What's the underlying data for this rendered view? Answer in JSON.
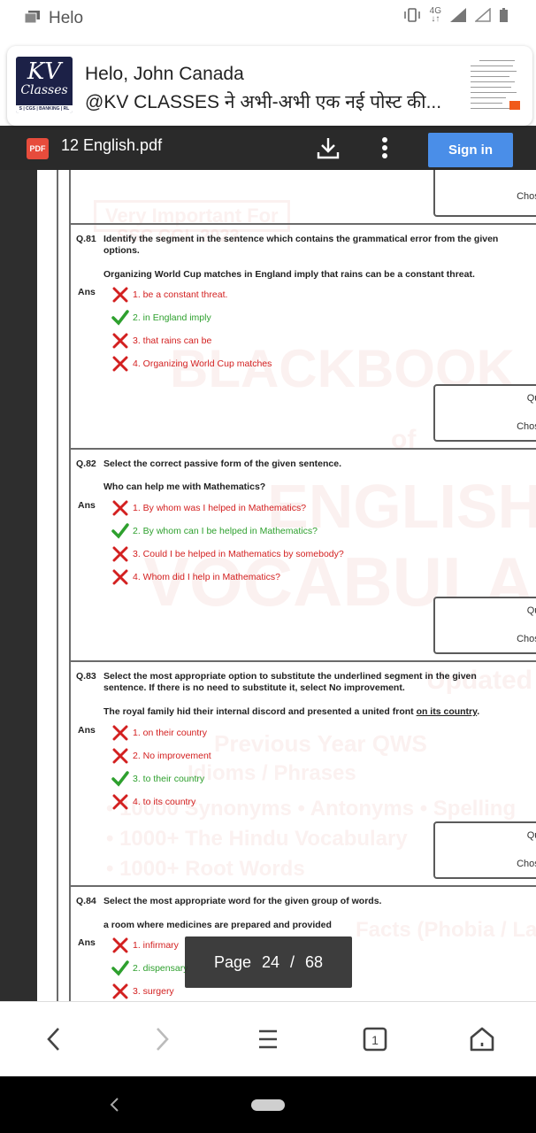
{
  "status_bar": {
    "title": "Helo",
    "network": "4G"
  },
  "notification": {
    "logo": {
      "kv": "KV",
      "classes": "Classes",
      "band": "S | CGS | BANKING | RL"
    },
    "title": "Helo, John Canada",
    "text": "@KV CLASSES ने अभी-अभी एक नई पोस्ट की..."
  },
  "pdf_header": {
    "badge": "PDF",
    "title": "12 English.pdf",
    "signin_label": "Sign in"
  },
  "document": {
    "info_labels": {
      "question_id": "Ques",
      "chosen_option": "Chosen"
    },
    "ans_label": "Ans",
    "questions": [
      {
        "number": "Q.81",
        "text": "Identify the segment in the sentence which contains the grammatical error from the given options.",
        "sentence": "Organizing World Cup matches in England imply that rains can be a constant threat.",
        "options": [
          {
            "label": "1. be a constant threat.",
            "correct": false
          },
          {
            "label": "2. in England imply",
            "correct": true
          },
          {
            "label": "3. that rains can be",
            "correct": false
          },
          {
            "label": "4. Organizing World Cup matches",
            "correct": false
          }
        ]
      },
      {
        "number": "Q.82",
        "text": "Select the correct passive form of the given sentence.",
        "sentence": "Who can help me with Mathematics?",
        "options": [
          {
            "label": "1. By whom was I helped in Mathematics?",
            "correct": false
          },
          {
            "label": "2. By whom can I be helped in Mathematics?",
            "correct": true
          },
          {
            "label": "3. Could I be helped in Mathematics by somebody?",
            "correct": false
          },
          {
            "label": "4. Whom did I help in Mathematics?",
            "correct": false
          }
        ]
      },
      {
        "number": "Q.83",
        "text": "Select the most appropriate option to substitute the underlined segment in the given sentence. If there is no need to substitute it, select No improvement.",
        "sentence_before": "The royal family hid their internal discord and presented a united front ",
        "sentence_underlined": "on its country",
        "sentence_after": ".",
        "options": [
          {
            "label": "1. on their country",
            "correct": false
          },
          {
            "label": "2. No improvement",
            "correct": false
          },
          {
            "label": "3. to their country",
            "correct": true
          },
          {
            "label": "4. to its country",
            "correct": false
          }
        ]
      },
      {
        "number": "Q.84",
        "text": "Select the most appropriate word for the given group of words.",
        "sentence": "a room where medicines are prepared and provided",
        "options": [
          {
            "label": "1. infirmary",
            "correct": false
          },
          {
            "label": "2. dispensary",
            "correct": true
          },
          {
            "label": "3. surgery",
            "correct": false
          }
        ]
      }
    ],
    "watermark": {
      "line1": "Very Important For",
      "line2": "SSC CGL 2023",
      "big1": "BLACKBOOK",
      "big2": "of",
      "big3": "ENGLISH",
      "big4": "VOCABULARY",
      "updated": "Updated till",
      "prev": "Previous Year QWS",
      "idioms": "Idioms / Phrases",
      "syn": "• 10000 Synonyms • Antonyms • Spelling",
      "hindu": "• 1000+ The Hindu Vocabulary",
      "root": "• 1000+ Root Words",
      "facts": "Facts (Phobia / Latin"
    }
  },
  "page_indicator": {
    "label": "Page",
    "current": "24",
    "separator": "/",
    "total": "68"
  },
  "colors": {
    "wrong": "#d32020",
    "right": "#2ea02e",
    "signin": "#4a8ee8",
    "pdf_badge": "#e74c3c"
  }
}
